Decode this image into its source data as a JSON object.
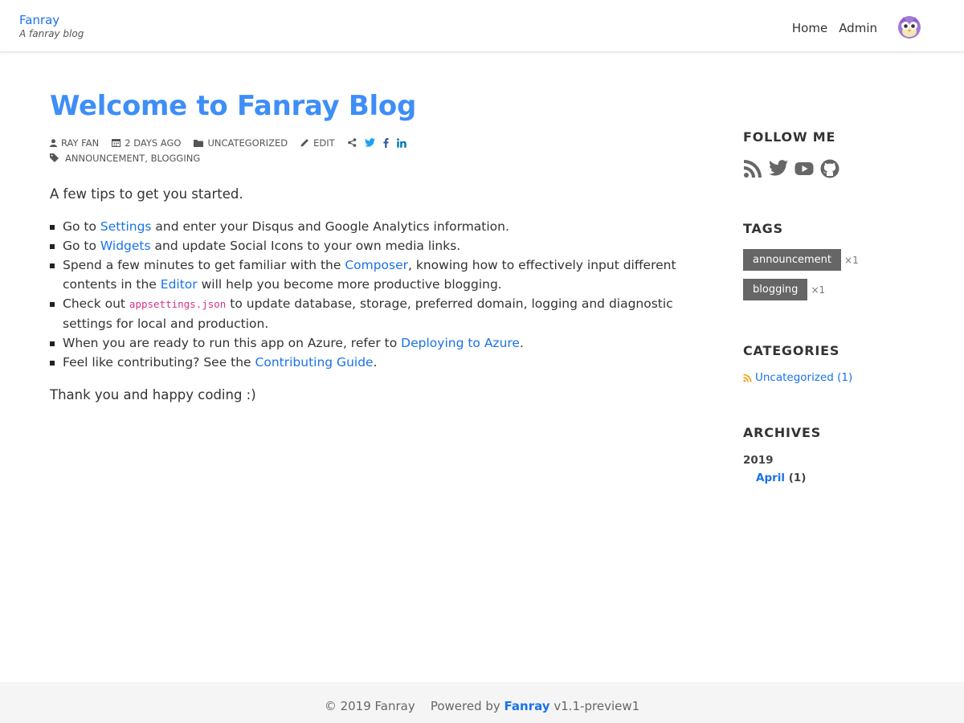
{
  "header": {
    "brand_name": "Fanray",
    "tagline": "A fanray blog",
    "nav": {
      "home": "Home",
      "admin": "Admin"
    }
  },
  "post": {
    "title": "Welcome to Fanray Blog",
    "meta": {
      "author": "RAY FAN",
      "date": "2 DAYS AGO",
      "category": "UNCATEGORIZED",
      "edit": "EDIT",
      "tags": "ANNOUNCEMENT, BLOGGING"
    },
    "intro": "A few tips to get you started.",
    "tips": [
      {
        "pre": "Go to ",
        "link": "Settings",
        "post": " and enter your Disqus and Google Analytics information."
      },
      {
        "pre": "Go to ",
        "link": "Widgets",
        "post": " and update Social Icons to your own media links."
      },
      {
        "pre": "Spend a few minutes to get familiar with the ",
        "link": "Composer",
        "mid": ", knowing how to effectively input different contents in the ",
        "link2": "Editor",
        "post": " will help you become more productive blogging."
      },
      {
        "pre": "Check out ",
        "code": "appsettings.json",
        "post": " to update database, storage, preferred domain, logging and diagnostic settings for local and production."
      },
      {
        "pre": "When you are ready to run this app on Azure, refer to ",
        "link": "Deploying to Azure",
        "post": "."
      },
      {
        "pre": "Feel like contributing? See the ",
        "link": "Contributing Guide",
        "post": "."
      }
    ],
    "outro": "Thank you and happy coding :)"
  },
  "sidebar": {
    "follow_title": "FOLLOW ME",
    "social_icons": [
      "rss-icon",
      "twitter-icon",
      "youtube-icon",
      "github-icon"
    ],
    "tags_title": "TAGS",
    "tags": [
      {
        "name": "announcement",
        "count": "×1"
      },
      {
        "name": "blogging",
        "count": "×1"
      }
    ],
    "categories_title": "CATEGORIES",
    "categories": [
      {
        "name": "Uncategorized (1)"
      }
    ],
    "archives_title": "ARCHIVES",
    "archives": [
      {
        "year": "2019",
        "month": "April",
        "count": "(1)"
      }
    ]
  },
  "footer": {
    "copyright": "© 2019 Fanray",
    "powered_prefix": "Powered by",
    "powered_brand": "Fanray",
    "version": "v1.1-preview1"
  },
  "colors": {
    "title_blue": "#3e8ef7",
    "link_blue": "#1a73e8",
    "tag_bg": "#666666",
    "code_pink": "#d63384",
    "rss_orange": "#f5a623",
    "twitter_blue": "#1da1f2",
    "facebook_blue": "#3b5998",
    "linkedin_blue": "#0077b5"
  }
}
